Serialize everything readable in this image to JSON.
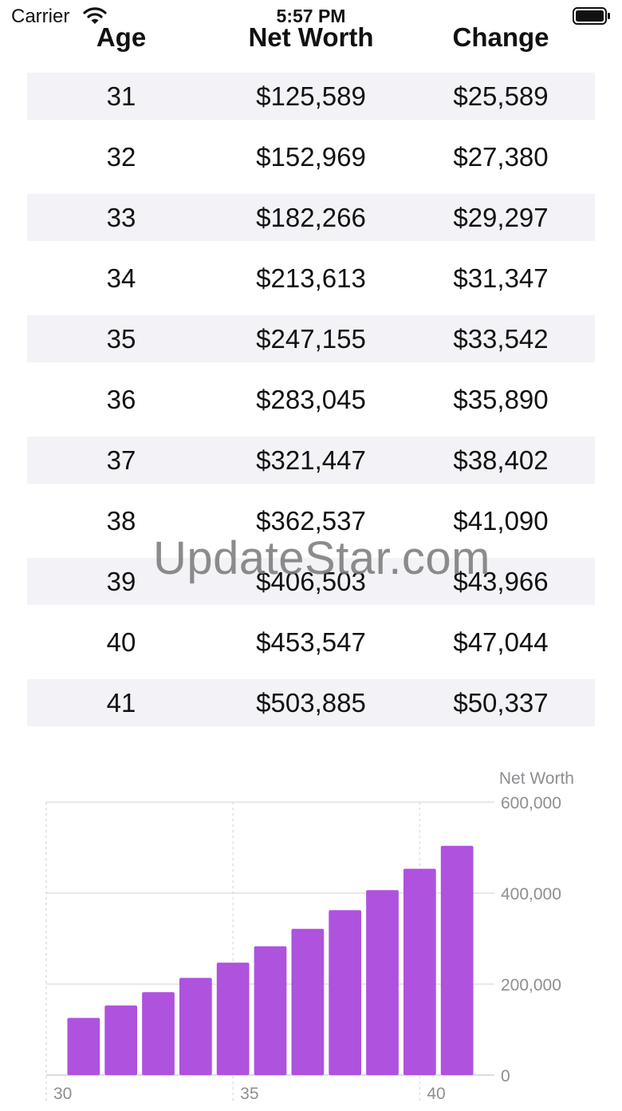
{
  "status_bar": {
    "carrier": "Carrier",
    "time": "5:57 PM"
  },
  "table": {
    "headers": [
      "Age",
      "Net Worth",
      "Change"
    ],
    "rows": [
      {
        "age": "31",
        "net_worth": "$125,589",
        "change": "$25,589"
      },
      {
        "age": "32",
        "net_worth": "$152,969",
        "change": "$27,380"
      },
      {
        "age": "33",
        "net_worth": "$182,266",
        "change": "$29,297"
      },
      {
        "age": "34",
        "net_worth": "$213,613",
        "change": "$31,347"
      },
      {
        "age": "35",
        "net_worth": "$247,155",
        "change": "$33,542"
      },
      {
        "age": "36",
        "net_worth": "$283,045",
        "change": "$35,890"
      },
      {
        "age": "37",
        "net_worth": "$321,447",
        "change": "$38,402"
      },
      {
        "age": "38",
        "net_worth": "$362,537",
        "change": "$41,090"
      },
      {
        "age": "39",
        "net_worth": "$406,503",
        "change": "$43,966"
      },
      {
        "age": "40",
        "net_worth": "$453,547",
        "change": "$47,044"
      },
      {
        "age": "41",
        "net_worth": "$503,885",
        "change": "$50,337"
      }
    ]
  },
  "watermark": "UpdateStar.com",
  "colors": {
    "bar": "#af52de",
    "row_shade": "#f2f2f7",
    "grid": "#d9d9d9",
    "axis_text": "#8e8e93"
  },
  "chart_data": {
    "type": "bar",
    "ylabel": "Net Worth",
    "x": [
      31,
      32,
      33,
      34,
      35,
      36,
      37,
      38,
      39,
      40,
      41
    ],
    "values": [
      125589,
      152969,
      182266,
      213613,
      247155,
      283045,
      321447,
      362537,
      406503,
      453547,
      503885
    ],
    "xlim": [
      30,
      42
    ],
    "ylim": [
      0,
      600000
    ],
    "x_ticks": [
      30,
      35,
      40
    ],
    "x_tick_labels": [
      "30",
      "35",
      "40"
    ],
    "y_ticks": [
      0,
      200000,
      400000,
      600000
    ],
    "y_tick_labels": [
      "0",
      "200,000",
      "400,000",
      "600,000"
    ],
    "grid": true
  }
}
